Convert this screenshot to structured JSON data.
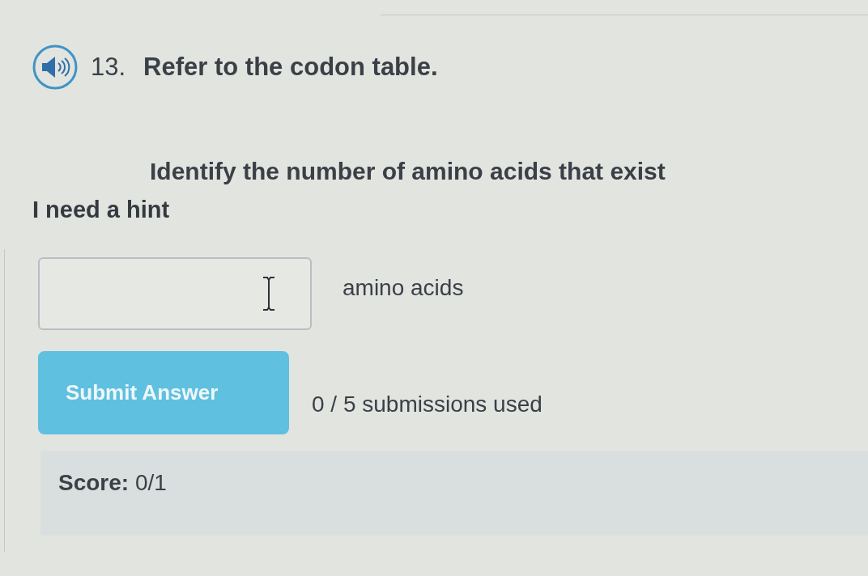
{
  "question": {
    "number": "13.",
    "prompt": "Refer to the codon table.",
    "instruction": "Identify the number of amino acids that exist"
  },
  "hint_link": "I need a hint",
  "answer": {
    "unit": "amino acids"
  },
  "submit_button": {
    "label": "Submit Answer"
  },
  "submissions": "0 / 5 submissions used",
  "score": "**Score:** 0/1"
}
